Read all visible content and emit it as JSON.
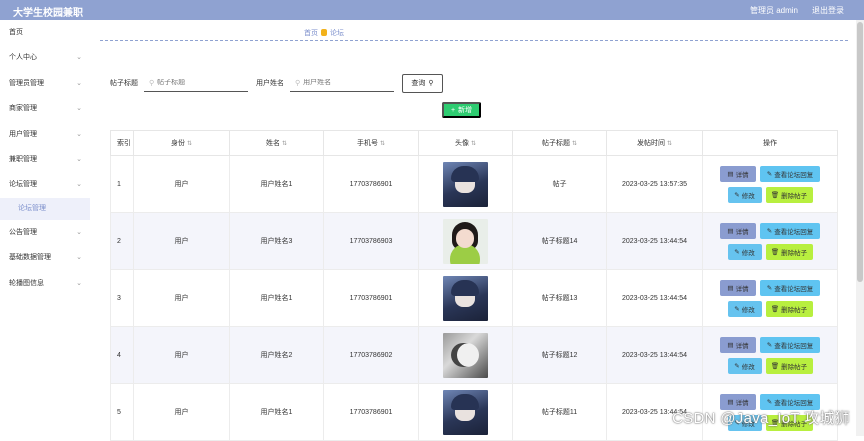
{
  "header": {
    "title": "大学生校园兼职",
    "user": "管理员 admin",
    "logout": "退出登录"
  },
  "sidebar": {
    "items": [
      {
        "label": "首页",
        "chevron": false
      },
      {
        "label": "个人中心",
        "chevron": true
      },
      {
        "label": "管理员管理",
        "chevron": true
      },
      {
        "label": "商家管理",
        "chevron": true
      },
      {
        "label": "用户管理",
        "chevron": true
      },
      {
        "label": "兼职管理",
        "chevron": true
      },
      {
        "label": "论坛管理",
        "chevron": true
      }
    ],
    "active_sub": "论坛管理",
    "items_after": [
      {
        "label": "公告管理",
        "chevron": true
      },
      {
        "label": "基础数据管理",
        "chevron": true
      },
      {
        "label": "轮播图信息",
        "chevron": true
      }
    ]
  },
  "breadcrumb": {
    "home": "首页",
    "current": "论坛"
  },
  "filters": {
    "title_label": "帖子标题",
    "title_placeholder": "帖子标题",
    "user_label": "用户姓名",
    "user_placeholder": "用户姓名",
    "search_button": "查询"
  },
  "add_button": "新增",
  "table": {
    "headers": [
      "索引",
      "身份",
      "姓名",
      "手机号",
      "头像",
      "帖子标题",
      "发帖时间",
      "操作"
    ],
    "sortable": [
      false,
      true,
      true,
      true,
      true,
      true,
      true,
      false
    ],
    "rows": [
      {
        "index": "1",
        "role": "用户",
        "name": "用户姓名1",
        "phone": "17703786901",
        "avatar": "av-a",
        "title": "帖子",
        "time": "2023-03-25 13:57:35"
      },
      {
        "index": "2",
        "role": "用户",
        "name": "用户姓名3",
        "phone": "17703786903",
        "avatar": "av-b",
        "title": "帖子标题14",
        "time": "2023-03-25 13:44:54"
      },
      {
        "index": "3",
        "role": "用户",
        "name": "用户姓名1",
        "phone": "17703786901",
        "avatar": "av-a",
        "title": "帖子标题13",
        "time": "2023-03-25 13:44:54"
      },
      {
        "index": "4",
        "role": "用户",
        "name": "用户姓名2",
        "phone": "17703786902",
        "avatar": "av-c",
        "title": "帖子标题12",
        "time": "2023-03-25 13:44:54"
      },
      {
        "index": "5",
        "role": "用户",
        "name": "用户姓名1",
        "phone": "17703786901",
        "avatar": "av-a",
        "title": "帖子标题11",
        "time": "2023-03-25 13:44:54"
      }
    ],
    "actions": {
      "detail": "详情",
      "view_replies": "查看论坛回复",
      "edit": "修改",
      "delete": "删除帖子"
    }
  },
  "watermark": "CSDN @Java_IoT 攻城狮",
  "colors": {
    "topbar": "#8fa2d1",
    "add_button": "#2ecc71",
    "detail": "#8a9cd0",
    "view": "#5fc4f1",
    "edit": "#66c3ef",
    "delete": "#b8ef3f"
  }
}
